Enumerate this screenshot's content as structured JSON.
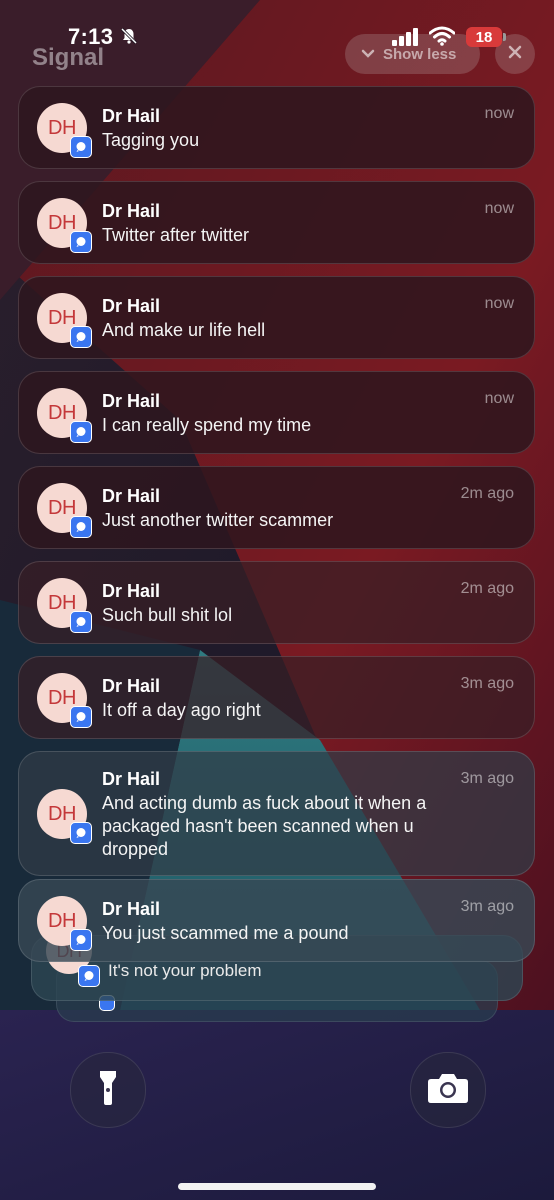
{
  "status_bar": {
    "time": "7:13",
    "battery": "18",
    "icons": [
      "bell-slash-icon",
      "cellular-signal-icon",
      "wifi-icon",
      "battery-icon"
    ]
  },
  "group": {
    "app_name": "Signal",
    "show_less_label": "Show less",
    "close_icon": "close-icon"
  },
  "notifications": [
    {
      "initials": "DH",
      "sender": "Dr Hail",
      "message": "Tagging you",
      "time": "now"
    },
    {
      "initials": "DH",
      "sender": "Dr Hail",
      "message": "Twitter after twitter",
      "time": "now"
    },
    {
      "initials": "DH",
      "sender": "Dr Hail",
      "message": "And make ur life hell",
      "time": "now"
    },
    {
      "initials": "DH",
      "sender": "Dr Hail",
      "message": "I can really spend my time",
      "time": "now"
    },
    {
      "initials": "DH",
      "sender": "Dr Hail",
      "message": "Just another twitter scammer",
      "time": "2m ago"
    },
    {
      "initials": "DH",
      "sender": "Dr Hail",
      "message": "Such bull shit lol",
      "time": "2m ago"
    },
    {
      "initials": "DH",
      "sender": "Dr Hail",
      "message": "It off a day ago right",
      "time": "3m ago"
    },
    {
      "initials": "DH",
      "sender": "Dr Hail",
      "message": "And acting dumb as fuck about it when a packaged hasn't been scanned when u dropped",
      "time": "3m ago"
    },
    {
      "initials": "DH",
      "sender": "Dr Hail",
      "message": "You just scammed me a pound",
      "time": "3m ago"
    }
  ],
  "stacked": {
    "message": "It's not your problem",
    "initials": "DH"
  },
  "quick_actions": {
    "flashlight": "flashlight-icon",
    "camera": "camera-icon"
  },
  "colors": {
    "avatar_bg": "#f6d9d2",
    "avatar_text": "#c4383a",
    "signal_blue": "#3a76f0",
    "battery_low": "#d83a3a"
  }
}
